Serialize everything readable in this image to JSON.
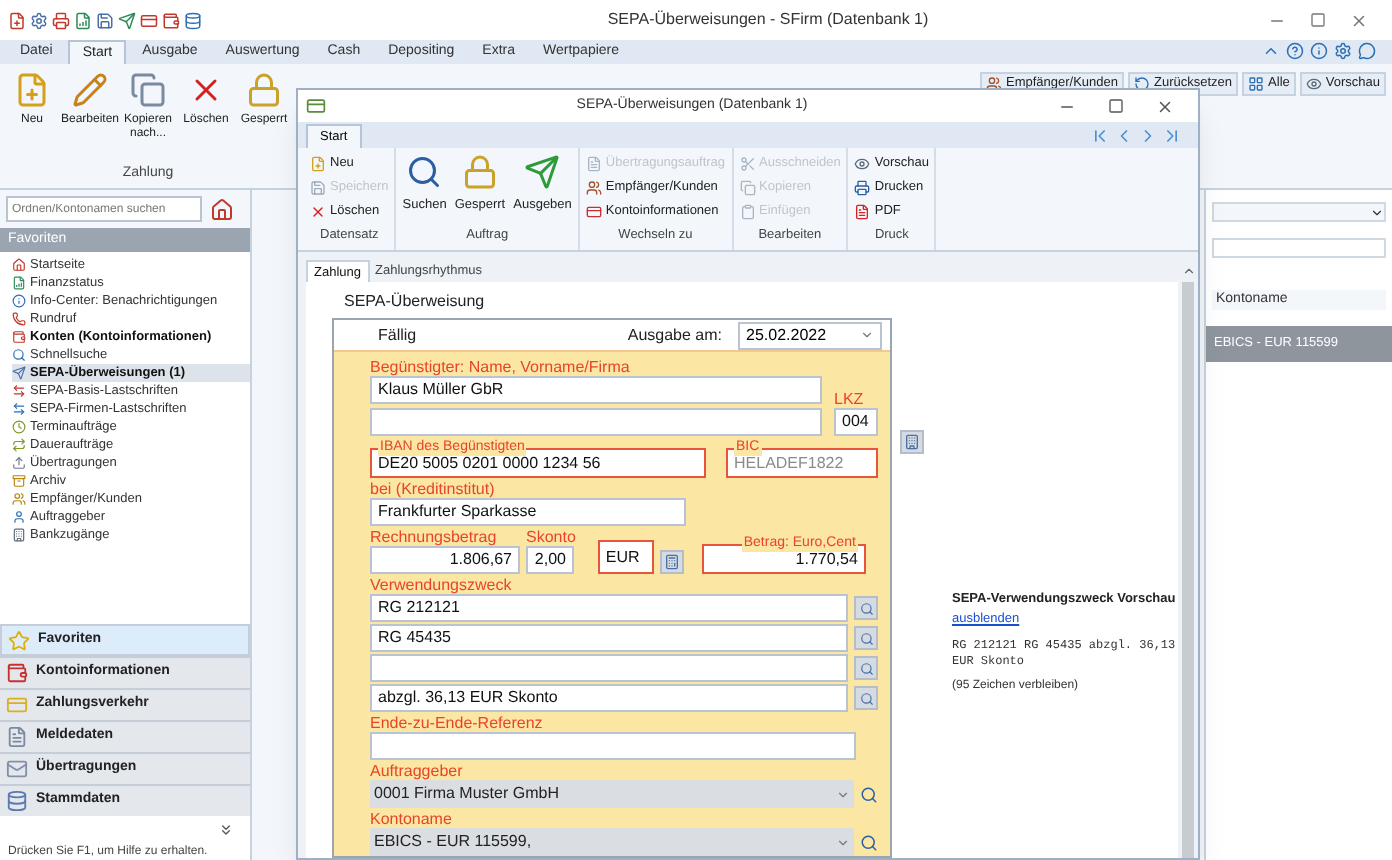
{
  "main_window": {
    "title": "SEPA-Überweisungen - SFirm (Datenbank 1)"
  },
  "menu_tabs": [
    {
      "label": "Datei",
      "selected": false
    },
    {
      "label": "Start",
      "selected": true
    },
    {
      "label": "Ausgabe",
      "selected": false
    },
    {
      "label": "Auswertung",
      "selected": false
    },
    {
      "label": "Cash",
      "selected": false
    },
    {
      "label": "Depositing",
      "selected": false
    },
    {
      "label": "Extra",
      "selected": false
    },
    {
      "label": "Wertpapiere",
      "selected": false
    }
  ],
  "main_ribbon": {
    "group": "Zahlung",
    "buttons": [
      "Neu",
      "Bearbeiten",
      "Kopieren nach...",
      "Löschen",
      "Gesperrt"
    ],
    "small_buttons": [
      "Empfänger/Kunden",
      "Zurücksetzen",
      "Alle",
      "Vorschau"
    ]
  },
  "sidebar": {
    "search_placeholder": "Ordnen/Kontonamen suchen",
    "header": "Favoriten",
    "items": [
      {
        "label": "Startseite",
        "bold": false,
        "selected": false
      },
      {
        "label": "Finanzstatus",
        "bold": false,
        "selected": false
      },
      {
        "label": "Info-Center: Benachrichtigungen",
        "bold": false,
        "selected": false
      },
      {
        "label": "Rundruf",
        "bold": false,
        "selected": false
      },
      {
        "label": "Konten (Kontoinformationen)",
        "bold": true,
        "selected": false
      },
      {
        "label": "Schnellsuche",
        "bold": false,
        "selected": false
      },
      {
        "label": "SEPA-Überweisungen (1)",
        "bold": true,
        "selected": true
      },
      {
        "label": "SEPA-Basis-Lastschriften",
        "bold": false,
        "selected": false
      },
      {
        "label": "SEPA-Firmen-Lastschriften",
        "bold": false,
        "selected": false
      },
      {
        "label": "Terminaufträge",
        "bold": false,
        "selected": false
      },
      {
        "label": "Daueraufträge",
        "bold": false,
        "selected": false
      },
      {
        "label": "Übertragungen",
        "bold": false,
        "selected": false
      },
      {
        "label": "Archiv",
        "bold": false,
        "selected": false
      },
      {
        "label": "Empfänger/Kunden",
        "bold": false,
        "selected": false
      },
      {
        "label": "Auftraggeber",
        "bold": false,
        "selected": false
      },
      {
        "label": "Bankzugänge",
        "bold": false,
        "selected": false
      }
    ],
    "nav": [
      {
        "label": "Favoriten",
        "selected": true
      },
      {
        "label": "Kontoinformationen",
        "selected": false
      },
      {
        "label": "Zahlungsverkehr",
        "selected": false
      },
      {
        "label": "Meldedaten",
        "selected": false
      },
      {
        "label": "Übertragungen",
        "selected": false
      },
      {
        "label": "Stammdaten",
        "selected": false
      }
    ]
  },
  "right_panel": {
    "column": "Kontoname",
    "row": "EBICS - EUR 115599"
  },
  "status_bar": "Drücken Sie F1, um Hilfe zu erhalten.",
  "dialog": {
    "title": "SEPA-Überweisungen (Datenbank 1)",
    "ribbon_tab": "Start",
    "groups": [
      {
        "label": "Datensatz",
        "kind": "small",
        "buttons": [
          {
            "label": "Neu",
            "disabled": false
          },
          {
            "label": "Speichern",
            "disabled": true
          },
          {
            "label": "Löschen",
            "disabled": false
          }
        ]
      },
      {
        "label": "Auftrag",
        "kind": "large",
        "buttons": [
          {
            "label": "Suchen",
            "disabled": false
          },
          {
            "label": "Gesperrt",
            "disabled": false
          },
          {
            "label": "Ausgeben",
            "disabled": false
          }
        ]
      },
      {
        "label": "Wechseln zu",
        "kind": "small",
        "buttons": [
          {
            "label": "Übertragungsauftrag",
            "disabled": true
          },
          {
            "label": "Empfänger/Kunden",
            "disabled": false
          },
          {
            "label": "Kontoinformationen",
            "disabled": false
          }
        ]
      },
      {
        "label": "Bearbeiten",
        "kind": "small",
        "buttons": [
          {
            "label": "Ausschneiden",
            "disabled": true
          },
          {
            "label": "Kopieren",
            "disabled": true
          },
          {
            "label": "Einfügen",
            "disabled": true
          }
        ]
      },
      {
        "label": "Druck",
        "kind": "small",
        "buttons": [
          {
            "label": "Vorschau",
            "disabled": false
          },
          {
            "label": "Drucken",
            "disabled": false
          },
          {
            "label": "PDF",
            "disabled": false
          }
        ]
      }
    ],
    "tabs": [
      {
        "label": "Zahlung",
        "selected": true
      },
      {
        "label": "Zahlungsrhythmus",
        "selected": false
      }
    ],
    "form": {
      "title": "SEPA-Überweisung",
      "due_label": "Fällig",
      "issue_label": "Ausgabe am:",
      "issue_date": "25.02.2022",
      "payee_label": "Begünstigter: Name, Vorname/Firma",
      "payee_name": "Klaus Müller GbR",
      "country_label": "LKZ",
      "country": "004",
      "iban_label": "IBAN des Begünstigten",
      "iban": "DE20 5005 0201 0000 1234 56",
      "bic_label": "BIC",
      "bic": "HELADEF1822",
      "bank_label": "bei (Kreditinstitut)",
      "bank": "Frankfurter Sparkasse",
      "invoice_label": "Rechnungsbetrag",
      "invoice_amount": "1.806,67",
      "discount_label": "Skonto",
      "discount": "2,00",
      "currency": "EUR",
      "amount_label": "Betrag: Euro,Cent",
      "amount": "1.770,54",
      "purpose_label": "Verwendungszweck",
      "purpose_lines": [
        {
          "kind": "text",
          "value": "RG 212121"
        },
        {
          "kind": "text",
          "value": "RG 45435"
        },
        {
          "kind": "blank"
        },
        {
          "kind": "text",
          "value": "abzgl. 36,13 EUR Skonto"
        }
      ],
      "e2e_label": "Ende-zu-Ende-Referenz",
      "originator_label": "Auftraggeber",
      "originator": "0001 Firma Muster GmbH",
      "account_label": "Kontoname",
      "account": "EBICS - EUR 115599,"
    },
    "preview": {
      "title": "SEPA-Verwendungszweck Vorschau",
      "link": "ausblenden",
      "text": "RG 212121 RG 45435 abzgl. 36,13 EUR Skonto",
      "remaining": "(95 Zeichen verbleiben)"
    }
  }
}
